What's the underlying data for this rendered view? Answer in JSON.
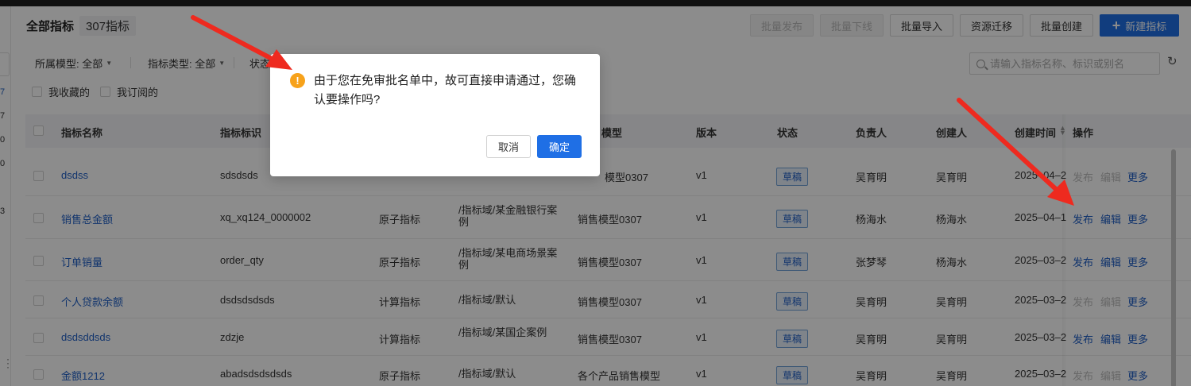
{
  "header": {
    "title": "全部指标",
    "count": "307指标"
  },
  "toolbar": {
    "batch_publish": "批量发布",
    "batch_offline": "批量下线",
    "batch_import": "批量导入",
    "resource_migrate": "资源迁移",
    "batch_create": "批量创建",
    "new_metric": "新建指标"
  },
  "filters": {
    "model_label": "所属模型: 全部",
    "type_label": "指标类型: 全部",
    "status_label": "状态",
    "favorited": "我收藏的",
    "subscribed": "我订阅的",
    "search_placeholder": "请输入指标名称、标识或别名"
  },
  "left_strip": [
    "7",
    "7",
    "0",
    "0",
    "3"
  ],
  "table": {
    "columns": [
      "指标名称",
      "指标标识",
      "",
      "",
      "模型",
      "版本",
      "状态",
      "负责人",
      "创建人",
      "创建时间",
      "操作"
    ],
    "rows": [
      {
        "name": "dsdss",
        "id": "sdsdsds",
        "type": "",
        "domain": "",
        "model": "模型0307",
        "version": "v1",
        "status": "草稿",
        "owner": "吴育明",
        "creator": "吴育明",
        "created": "2025–04–2",
        "actions": [
          "发布",
          "编辑",
          "更多"
        ],
        "active": [
          false,
          false,
          true
        ]
      },
      {
        "name": "销售总金额",
        "id": "xq_xq124_0000002",
        "type": "原子指标",
        "domain": "/指标域/某金融银行案例",
        "model": "销售模型0307",
        "version": "v1",
        "status": "草稿",
        "owner": "杨海水",
        "creator": "杨海水",
        "created": "2025–04–1",
        "actions": [
          "发布",
          "编辑",
          "更多"
        ],
        "active": [
          true,
          true,
          true
        ]
      },
      {
        "name": "订单销量",
        "id": "order_qty",
        "type": "原子指标",
        "domain": "/指标域/某电商场景案例",
        "model": "销售模型0307",
        "version": "v1",
        "status": "草稿",
        "owner": "张梦琴",
        "creator": "杨海水",
        "created": "2025–03–2",
        "actions": [
          "发布",
          "编辑",
          "更多"
        ],
        "active": [
          true,
          true,
          true
        ]
      },
      {
        "name": "个人贷款余额",
        "id": "dsdsdsdsds",
        "type": "计算指标",
        "domain": "/指标域/默认",
        "model": "销售模型0307",
        "version": "v1",
        "status": "草稿",
        "owner": "吴育明",
        "creator": "吴育明",
        "created": "2025–03–2",
        "actions": [
          "发布",
          "编辑",
          "更多"
        ],
        "active": [
          false,
          false,
          true
        ]
      },
      {
        "name": "dsdsddsds",
        "id": "zdzje",
        "type": "计算指标",
        "domain": "/指标域/某国企案例",
        "model": "销售模型0307",
        "version": "v1",
        "status": "草稿",
        "owner": "吴育明",
        "creator": "吴育明",
        "created": "2025–03–2",
        "actions": [
          "发布",
          "编辑",
          "更多"
        ],
        "active": [
          true,
          true,
          true
        ]
      },
      {
        "name": "金额1212",
        "id": "abadsdsdsdsds",
        "type": "原子指标",
        "domain": "/指标域/默认",
        "model": "各个产品销售模型",
        "version": "v1",
        "status": "草稿",
        "owner": "吴育明",
        "creator": "吴育明",
        "created": "2025–03–2",
        "actions": [
          "发布",
          "编辑",
          "更多"
        ],
        "active": [
          false,
          false,
          true
        ]
      }
    ]
  },
  "dialog": {
    "message": "由于您在免审批名单中，故可直接申请通过，您确认要操作吗?",
    "cancel": "取消",
    "confirm": "确定"
  },
  "colors": {
    "primary": "#1f6fe5",
    "link": "#1f5fc6",
    "warning": "#f7a21b",
    "annotation_arrow": "#ee2a1f"
  }
}
